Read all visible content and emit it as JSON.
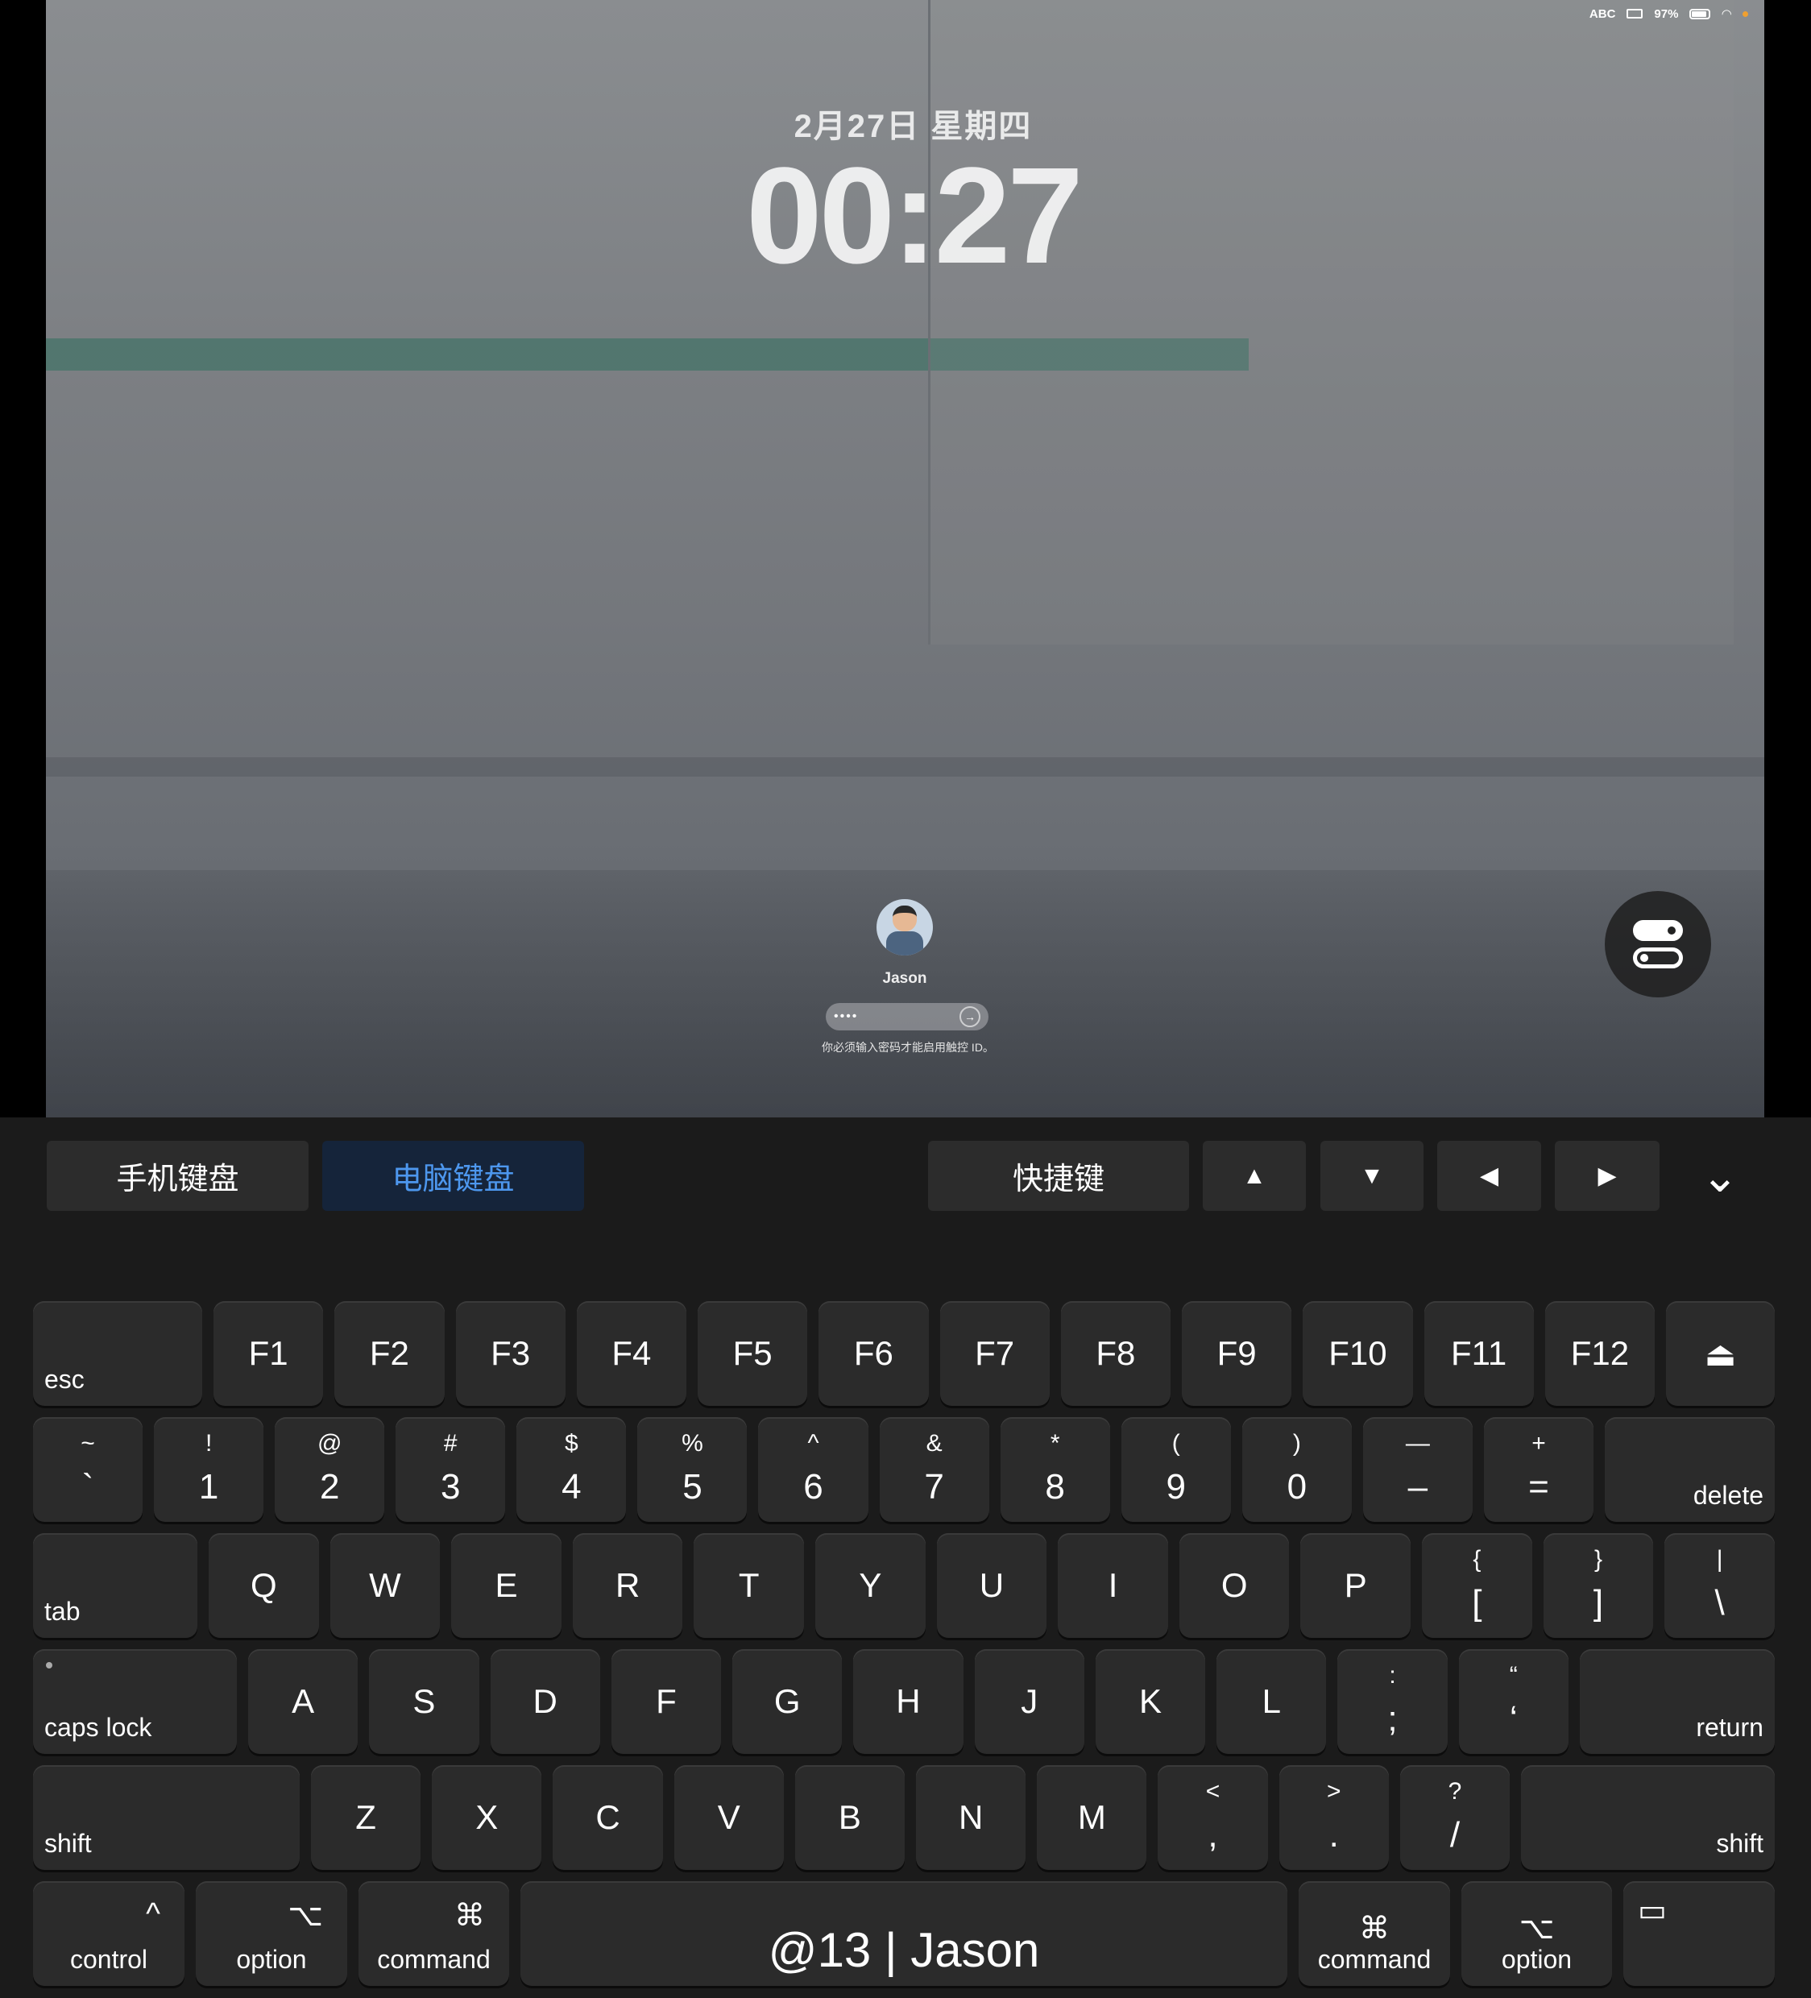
{
  "status_bar": {
    "input_method": "ABC",
    "battery": "97%",
    "battery_level": 97
  },
  "lock_screen": {
    "date": "2月27日 星期四",
    "time": "00:27",
    "user_name": "Jason",
    "password_mask": "••••",
    "hint": "你必须输入密码才能启用触控 ID。"
  },
  "toolbar": {
    "phone_keyboard": "手机键盘",
    "computer_keyboard": "电脑键盘",
    "shortcuts": "快捷键",
    "up": "▲",
    "down": "▼",
    "left": "◀",
    "right": "▶",
    "collapse": "⌄",
    "accent": "#4d97ee"
  },
  "keyboard": {
    "row1": [
      "esc",
      "F1",
      "F2",
      "F3",
      "F4",
      "F5",
      "F6",
      "F7",
      "F8",
      "F9",
      "F10",
      "F11",
      "F12",
      "⏏"
    ],
    "row2": [
      [
        "~",
        "`"
      ],
      [
        "!",
        "1"
      ],
      [
        "@",
        "2"
      ],
      [
        "#",
        "3"
      ],
      [
        "$",
        "4"
      ],
      [
        "%",
        "5"
      ],
      [
        "^",
        "6"
      ],
      [
        "&",
        "7"
      ],
      [
        "*",
        "8"
      ],
      [
        "(",
        "9"
      ],
      [
        ")",
        "0"
      ],
      [
        "—",
        "–"
      ],
      [
        "+",
        "="
      ]
    ],
    "delete": "delete",
    "tab": "tab",
    "row3": [
      "Q",
      "W",
      "E",
      "R",
      "T",
      "Y",
      "U",
      "I",
      "O",
      "P"
    ],
    "row3_sym": [
      [
        "{",
        "["
      ],
      [
        "}",
        "]"
      ],
      [
        "|",
        "\\"
      ]
    ],
    "caps": "caps lock",
    "row4": [
      "A",
      "S",
      "D",
      "F",
      "G",
      "H",
      "J",
      "K",
      "L"
    ],
    "row4_sym": [
      [
        ":",
        ";"
      ],
      [
        "“",
        "‘"
      ]
    ],
    "return": "return",
    "shift": "shift",
    "row5": [
      "Z",
      "X",
      "C",
      "V",
      "B",
      "N",
      "M"
    ],
    "row5_sym": [
      [
        "<",
        ","
      ],
      [
        ">",
        "."
      ],
      [
        "?",
        "/"
      ]
    ],
    "control": {
      "sym": "^",
      "label": "control"
    },
    "option": {
      "sym": "⌥",
      "label": "option"
    },
    "command": {
      "sym": "⌘",
      "label": "command"
    },
    "space": "@13 | Jason",
    "last": {
      "sym": "▭"
    }
  }
}
